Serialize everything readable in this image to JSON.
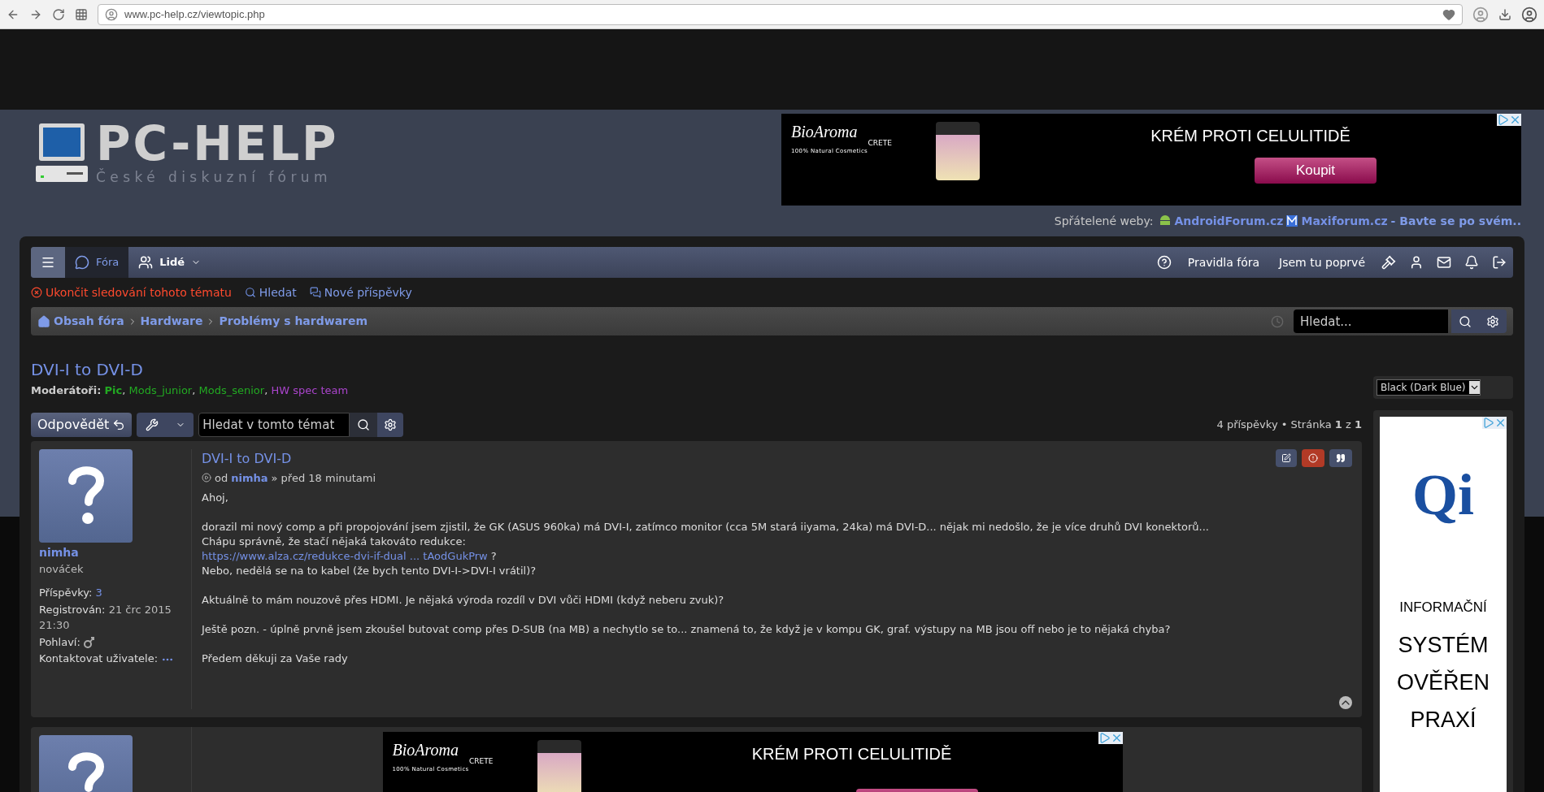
{
  "browser": {
    "url": "www.pc-help.cz/viewtopic.php"
  },
  "header": {
    "logo_title": "PC-HELP",
    "logo_subtitle": "České diskuzní fórum"
  },
  "top_ad": {
    "brand": "BioAroma",
    "brand_region": "CRETE",
    "brand_tagline": "100% Natural Cosmetics",
    "headline": "KRÉM PROTI CELULITIDĚ",
    "button": "Koupit"
  },
  "friendly_sites": {
    "label": "Spřátelené weby:",
    "links": [
      {
        "kind": "android",
        "text": "AndroidForum.cz"
      },
      {
        "kind": "maxi",
        "text": "Maxiforum.cz"
      },
      {
        "kind": "plain",
        "text": "- Bavte se po svém.."
      }
    ]
  },
  "nav": {
    "left": [
      {
        "kind": "menu",
        "selected": false
      },
      {
        "kind": "forums",
        "label": "Fóra",
        "selected": true
      },
      {
        "kind": "people",
        "label": "Lidé",
        "selected": false
      }
    ],
    "right": [
      {
        "kind": "help"
      },
      {
        "kind": "text",
        "label": "Pravidla fóra"
      },
      {
        "kind": "text",
        "label": "Jsem tu poprvé"
      },
      {
        "kind": "moderate"
      },
      {
        "kind": "user"
      },
      {
        "kind": "messages"
      },
      {
        "kind": "notifications"
      },
      {
        "kind": "logout"
      }
    ]
  },
  "quick_links": [
    {
      "kind": "unsubscribe",
      "label": "Ukončit sledování tohoto tématu"
    },
    {
      "kind": "search",
      "label": "Hledat"
    },
    {
      "kind": "new",
      "label": "Nové příspěvky"
    }
  ],
  "breadcrumbs": [
    "Obsah fóra",
    "Hardware",
    "Problémy s hardwarem"
  ],
  "header_search": {
    "placeholder": "Hledat..."
  },
  "topic": {
    "title": "DVI-I to DVI-D",
    "moderators_label": "Moderátoři:",
    "separator": ",",
    "moderators": [
      {
        "name": "Pic",
        "color": "#22aa22",
        "bold": true
      },
      {
        "name": "Mods_junior",
        "color": "#22aa22",
        "bold": false
      },
      {
        "name": "Mods_senior",
        "color": "#22aa22",
        "bold": false
      },
      {
        "name": "HW spec team",
        "color": "#aa44cc",
        "bold": false
      }
    ]
  },
  "style_select": {
    "value": "Black (Dark Blue)"
  },
  "actions": {
    "reply": "Odpovědět",
    "topic_search_placeholder": "Hledat v tomto témat"
  },
  "pagination": "4 příspěvky • Stránka **1** z **1**",
  "post": {
    "title": "DVI-I to DVI-D",
    "by": "od",
    "author": "nimha",
    "time": "» před 18 minutami",
    "profile": {
      "name": "nimha",
      "rank": "nováček",
      "fields": [
        {
          "kind": "link",
          "label": "Příspěvky:",
          "value": "3"
        },
        {
          "kind": "text",
          "label": "Registrován:",
          "value": "21 črc 2015 21:30"
        },
        {
          "kind": "gender",
          "label": "Pohlaví:"
        },
        {
          "kind": "contact",
          "label": "Kontaktovat uživatele:"
        }
      ]
    },
    "body": [
      {
        "kind": "text",
        "text": "Ahoj,"
      },
      {
        "kind": "gap"
      },
      {
        "kind": "text",
        "text": "dorazil mi nový comp a při propojování jsem zjistil, že GK (ASUS 960ka) má DVI-I, zatímco monitor (cca 5M stará iiyama, 24ka) má DVI-D... nějak mi nedošlo, že je více druhů DVI konektorů..."
      },
      {
        "kind": "text",
        "text": "Chápu správně, že stačí nějaká takováto redukce:"
      },
      {
        "kind": "link",
        "text": "https://www.alza.cz/redukce-dvi-if-dual ... tAodGukPrw",
        "after": "?"
      },
      {
        "kind": "text",
        "text": "Nebo, nedělá se na to kabel (že bych tento DVI-I->DVI-I vrátil)?"
      },
      {
        "kind": "gap"
      },
      {
        "kind": "text",
        "text": "Aktuálně to mám nouzově přes HDMI. Je nějaká výroda rozdíl v DVI vůči HDMI (když neberu zvuk)?"
      },
      {
        "kind": "gap"
      },
      {
        "kind": "text",
        "text": "Ještě pozn. - úplně prvně jsem zkoušel butovat comp přes D-SUB (na MB) a nechytlo se to... znamená to, že když je v kompu GK, graf. výstupy na MB jsou off nebo je to nějaká chyba?"
      },
      {
        "kind": "gap"
      },
      {
        "kind": "text",
        "text": "Předem děkuji za Vaše rady"
      }
    ]
  },
  "side_ad": {
    "logo": "Qi",
    "lines": [
      "INFORMAČNÍ",
      "SYSTÉM",
      "OVĚŘEN",
      "PRAXÍ"
    ]
  },
  "second_ad": {
    "brand": "BioAroma",
    "brand_region": "CRETE",
    "brand_tagline": "100% Natural Cosmetics",
    "headline": "KRÉM PROTI CELULITIDĚ"
  }
}
